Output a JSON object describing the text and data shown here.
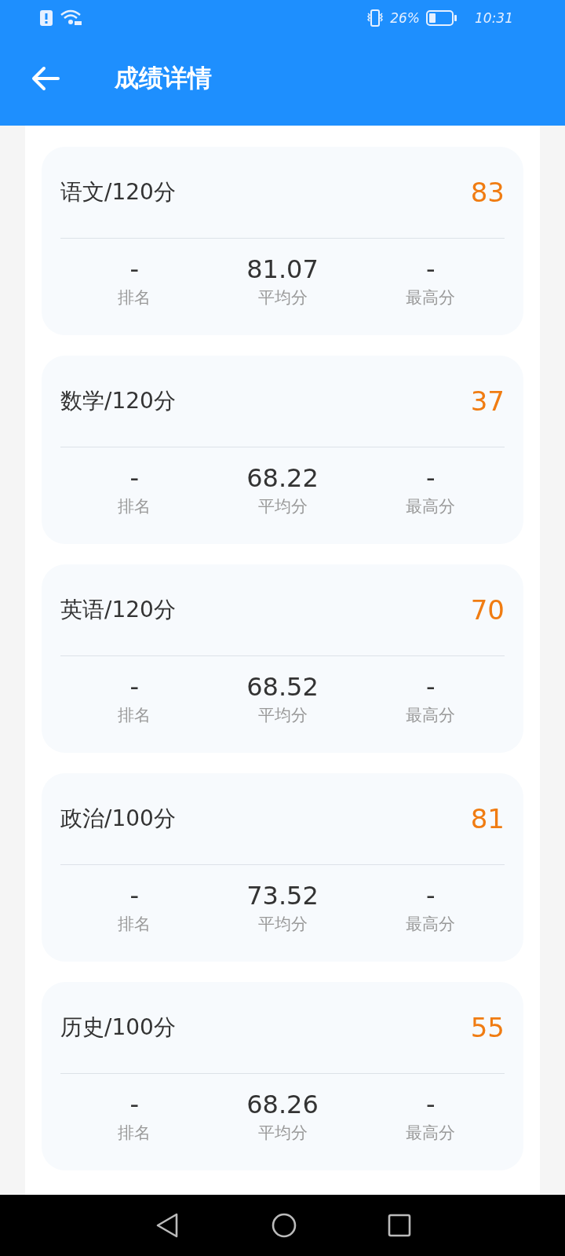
{
  "status_bar": {
    "battery_text": "26%",
    "time": "10:31"
  },
  "header": {
    "title": "成绩详情"
  },
  "subjects": [
    {
      "name": "语文/120分",
      "score": "83",
      "stats": [
        {
          "value": "-",
          "label": "排名"
        },
        {
          "value": "81.07",
          "label": "平均分"
        },
        {
          "value": "-",
          "label": "最高分"
        }
      ]
    },
    {
      "name": "数学/120分",
      "score": "37",
      "stats": [
        {
          "value": "-",
          "label": "排名"
        },
        {
          "value": "68.22",
          "label": "平均分"
        },
        {
          "value": "-",
          "label": "最高分"
        }
      ]
    },
    {
      "name": "英语/120分",
      "score": "70",
      "stats": [
        {
          "value": "-",
          "label": "排名"
        },
        {
          "value": "68.52",
          "label": "平均分"
        },
        {
          "value": "-",
          "label": "最高分"
        }
      ]
    },
    {
      "name": "政治/100分",
      "score": "81",
      "stats": [
        {
          "value": "-",
          "label": "排名"
        },
        {
          "value": "73.52",
          "label": "平均分"
        },
        {
          "value": "-",
          "label": "最高分"
        }
      ]
    },
    {
      "name": "历史/100分",
      "score": "55",
      "stats": [
        {
          "value": "-",
          "label": "排名"
        },
        {
          "value": "68.26",
          "label": "平均分"
        },
        {
          "value": "-",
          "label": "最高分"
        }
      ]
    }
  ]
}
